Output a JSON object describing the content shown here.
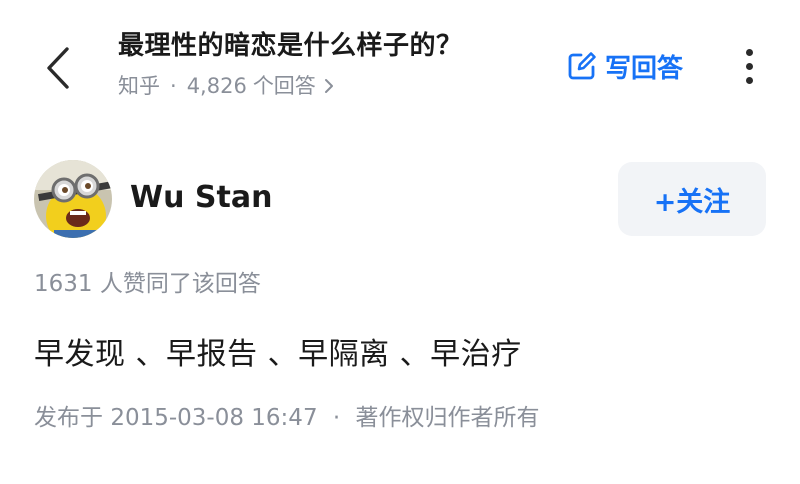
{
  "header": {
    "question_title": "最理性的暗恋是什么样子的？",
    "source": "知乎",
    "meta_separator": "·",
    "answer_count": "4,826",
    "answer_count_suffix": "个回答",
    "write_answer_label": "写回答"
  },
  "icons": {
    "back": "chevron-left-icon",
    "meta_chevron": "chevron-right-icon",
    "write": "edit-pencil-icon",
    "more": "more-vertical-icon"
  },
  "author": {
    "name": "Wu Stan",
    "follow_label": "+关注"
  },
  "answer": {
    "likes_text": "1631 人赞同了该回答",
    "content": "早发现 、早报告 、早隔离 、早治疗",
    "published_prefix": "发布于",
    "published_time": "2015-03-08 16:47",
    "separator": "·",
    "copyright": "著作权归作者所有"
  },
  "colors": {
    "accent_blue": "#1772f6",
    "meta_gray": "#8a8f99",
    "text_dark": "#1a1a1a",
    "follow_bg": "#f2f4f7"
  }
}
